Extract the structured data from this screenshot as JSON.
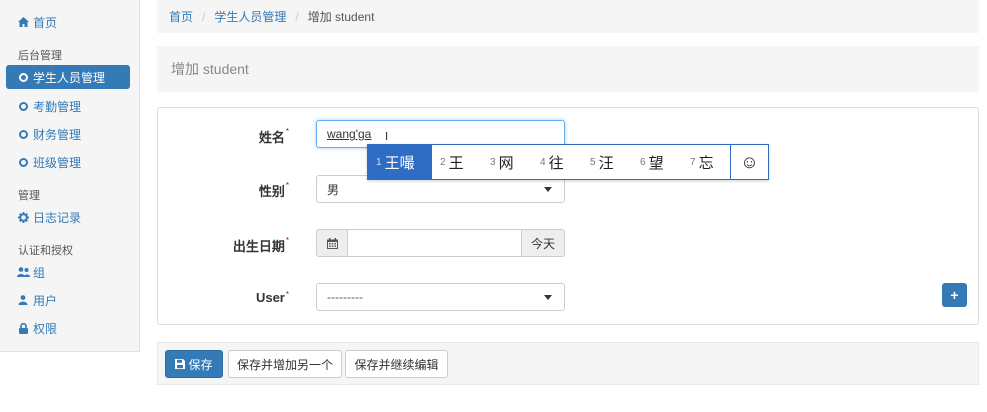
{
  "sidebar": {
    "home": "首页",
    "section_backend": "后台管理",
    "items_backend": [
      "学生人员管理",
      "考勤管理",
      "财务管理",
      "班级管理"
    ],
    "section_manage": "管理",
    "log": "日志记录",
    "section_auth": "认证和授权",
    "items_auth": [
      "组",
      "用户",
      "权限"
    ]
  },
  "breadcrumb": {
    "home": "首页",
    "parent": "学生人员管理",
    "current": "增加 student"
  },
  "page_title": "增加 student",
  "form": {
    "name_label": "姓名",
    "name_value": "wang'ga",
    "gender_label": "性别",
    "gender_value": "男",
    "birth_label": "出生日期",
    "birth_value": "",
    "today_label": "今天",
    "user_label": "User",
    "user_value": "---------",
    "required_mark": "*"
  },
  "ime": {
    "candidates": [
      {
        "num": "1",
        "text": "王嘬"
      },
      {
        "num": "2",
        "text": "王"
      },
      {
        "num": "3",
        "text": "网"
      },
      {
        "num": "4",
        "text": "往"
      },
      {
        "num": "5",
        "text": "汪"
      },
      {
        "num": "6",
        "text": "望"
      },
      {
        "num": "7",
        "text": "忘"
      }
    ],
    "emoji": "☺"
  },
  "buttons": {
    "save": "保存",
    "save_add_another": "保存并增加另一个",
    "save_continue": "保存并继续编辑",
    "add_user": "+"
  },
  "colors": {
    "primary": "#337ab7",
    "ime_blue": "#2f6cc4"
  }
}
